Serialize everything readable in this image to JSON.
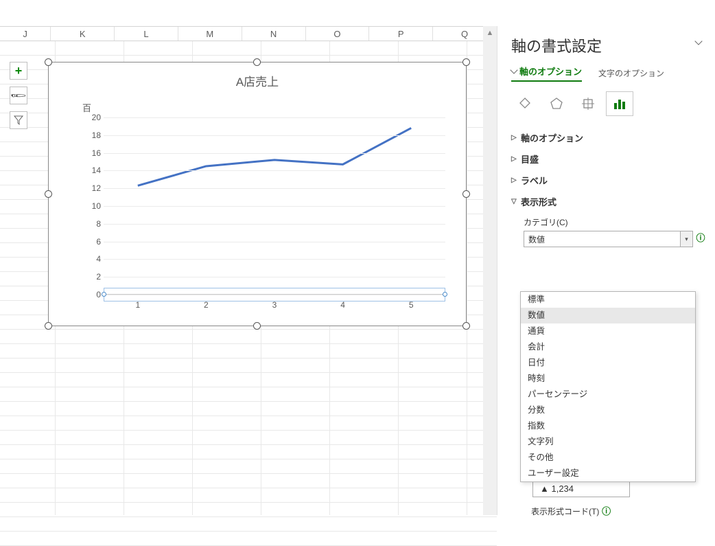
{
  "columns": [
    "J",
    "K",
    "L",
    "M",
    "N",
    "O",
    "P",
    "Q"
  ],
  "chart_data": {
    "type": "line",
    "title": "A店売上",
    "ylabel_unit": "百",
    "categories": [
      "1",
      "2",
      "3",
      "4",
      "5"
    ],
    "values": [
      12.3,
      14.5,
      15.2,
      14.7,
      18.8
    ],
    "yticks": [
      0,
      2,
      4,
      6,
      8,
      10,
      12,
      14,
      16,
      18,
      20
    ],
    "ylim": [
      0,
      20
    ]
  },
  "panel": {
    "title": "軸の書式設定",
    "tab_active": "軸のオプション",
    "tab_inactive": "文字のオプション",
    "sections": {
      "axis_options": "軸のオプション",
      "ticks": "目盛",
      "labels": "ラベル",
      "number_format": "表示形式"
    },
    "number_format": {
      "category_label": "カテゴリ(C)",
      "selected": "数値",
      "options": [
        "標準",
        "数値",
        "通貨",
        "会計",
        "日付",
        "時刻",
        "パーセンテージ",
        "分数",
        "指数",
        "文字列",
        "その他",
        "ユーザー設定"
      ],
      "sample": "▲ 1,234",
      "code_label": "表示形式コード(T)"
    }
  }
}
